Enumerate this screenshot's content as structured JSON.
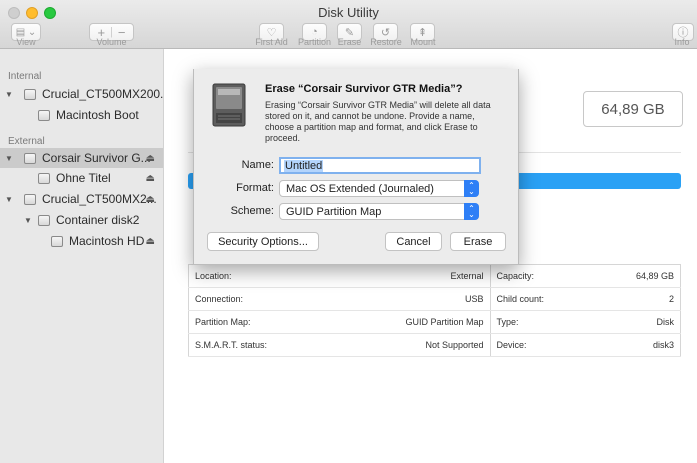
{
  "window": {
    "title": "Disk Utility"
  },
  "toolbar": {
    "view_label": "View",
    "volume_label": "Volume",
    "first_aid_label": "First Aid",
    "partition_label": "Partition",
    "erase_label": "Erase",
    "restore_label": "Restore",
    "mount_label": "Mount",
    "info_label": "Info"
  },
  "sidebar": {
    "internal_header": "Internal",
    "external_header": "External",
    "items": [
      {
        "label": "Crucial_CT500MX200..."
      },
      {
        "label": "Macintosh Boot"
      },
      {
        "label": "Corsair Survivor G..."
      },
      {
        "label": "Ohne Titel"
      },
      {
        "label": "Crucial_CT500MX2..."
      },
      {
        "label": "Container disk2"
      },
      {
        "label": "Macintosh HD"
      }
    ]
  },
  "main": {
    "capacity": "64,89 GB",
    "info": [
      {
        "left_label": "Location:",
        "left_value": "External",
        "right_label": "Capacity:",
        "right_value": "64,89 GB"
      },
      {
        "left_label": "Connection:",
        "left_value": "USB",
        "right_label": "Child count:",
        "right_value": "2"
      },
      {
        "left_label": "Partition Map:",
        "left_value": "GUID Partition Map",
        "right_label": "Type:",
        "right_value": "Disk"
      },
      {
        "left_label": "S.M.A.R.T. status:",
        "left_value": "Not Supported",
        "right_label": "Device:",
        "right_value": "disk3"
      }
    ]
  },
  "sheet": {
    "title": "Erase “Corsair Survivor GTR Media”?",
    "message": "Erasing “Corsair Survivor GTR Media” will delete all data stored on it, and cannot be undone. Provide a name, choose a partition map and format, and click Erase to proceed.",
    "name_label": "Name:",
    "name_value": "Untitled",
    "format_label": "Format:",
    "format_value": "Mac OS Extended (Journaled)",
    "scheme_label": "Scheme:",
    "scheme_value": "GUID Partition Map",
    "security_button": "Security Options...",
    "cancel_button": "Cancel",
    "erase_button": "Erase"
  },
  "colors": {
    "accent": "#2e7ff6",
    "usage_bar": "#2aa1f5",
    "selection": "#cbcbcb"
  }
}
